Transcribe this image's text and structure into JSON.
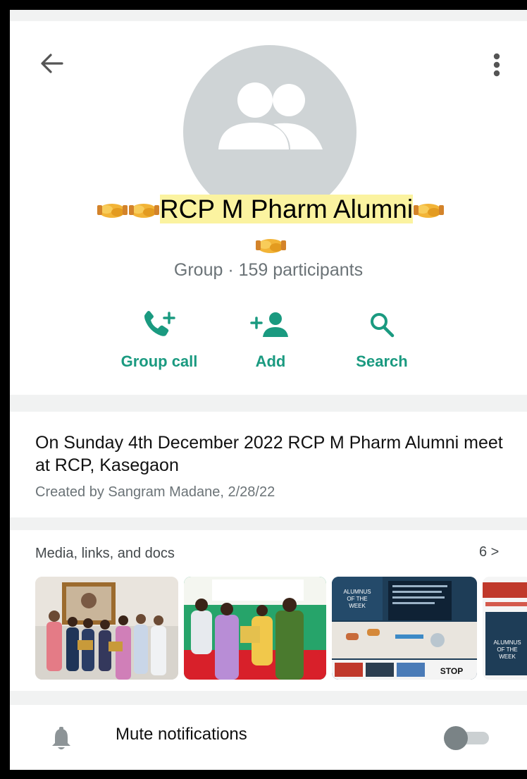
{
  "header": {
    "back_icon": "arrow-left-icon",
    "menu_icon": "more-vertical-icon",
    "avatar_icon": "group-avatar-icon",
    "group_name_emoji_prefix": "handshake-emoji",
    "group_name": "RCP M Pharm Alumni",
    "group_info": "Group · 159 participants"
  },
  "actions": [
    {
      "label": "Group call",
      "icon": "add-call-icon"
    },
    {
      "label": "Add",
      "icon": "add-person-icon"
    },
    {
      "label": "Search",
      "icon": "search-icon"
    }
  ],
  "description": {
    "text": "On Sunday 4th December 2022 RCP M Pharm Alumni meet at RCP, Kasegaon",
    "meta": "Created by Sangram Madane, 2/28/22"
  },
  "media": {
    "title": "Media, links, and docs",
    "count": "6 >",
    "thumbnails": [
      {
        "desc": "award-photo"
      },
      {
        "desc": "award-photo-outdoor"
      },
      {
        "desc": "alumnus-of-the-week-poster",
        "text": "ALUMNUS OF THE WEEK"
      },
      {
        "desc": "alumnus-of-the-week-poster-2",
        "text": "ALUMNUS OF THE WEEK"
      }
    ]
  },
  "settings": {
    "mute_label": "Mute notifications",
    "mute_icon": "bell-icon",
    "mute_enabled": false
  },
  "colors": {
    "accent": "#1a9a80",
    "highlight": "#fbf3a0",
    "secondary_text": "#6b7377",
    "background": "#f1f2f2"
  }
}
